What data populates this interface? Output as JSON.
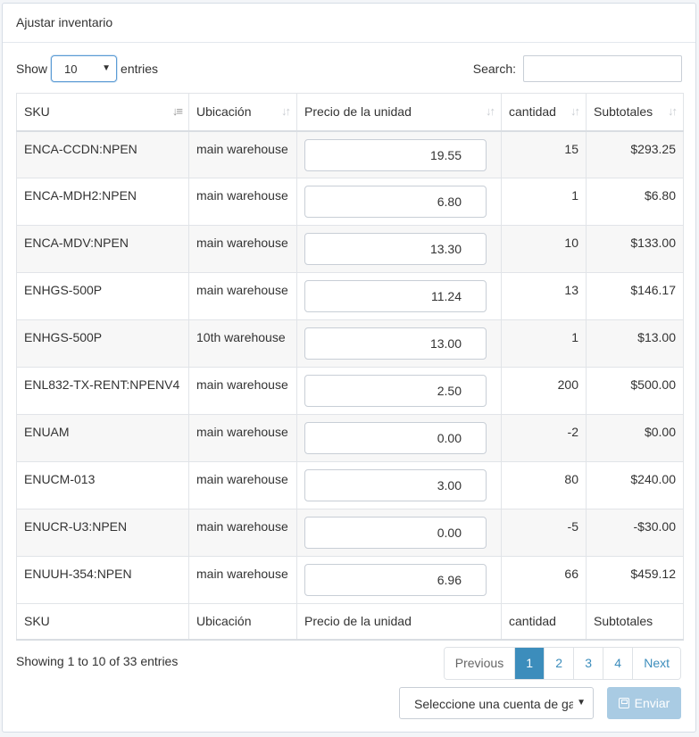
{
  "panel": {
    "title": "Ajustar inventario"
  },
  "length": {
    "show_label": "Show",
    "entries_label": "entries",
    "value": "10"
  },
  "search": {
    "label": "Search:",
    "value": ""
  },
  "columns": [
    "SKU",
    "Ubicación",
    "Precio de la unidad",
    "cantidad",
    "Subtotales"
  ],
  "rows": [
    {
      "sku": "ENCA-CCDN:NPEN",
      "location": "main warehouse",
      "price": "19.55",
      "qty": "15",
      "subtotal": "$293.25"
    },
    {
      "sku": "ENCA-MDH2:NPEN",
      "location": "main warehouse",
      "price": "6.80",
      "qty": "1",
      "subtotal": "$6.80"
    },
    {
      "sku": "ENCA-MDV:NPEN",
      "location": "main warehouse",
      "price": "13.30",
      "qty": "10",
      "subtotal": "$133.00"
    },
    {
      "sku": "ENHGS-500P",
      "location": "main warehouse",
      "price": "11.24",
      "qty": "13",
      "subtotal": "$146.17"
    },
    {
      "sku": "ENHGS-500P",
      "location": "10th warehouse",
      "price": "13.00",
      "qty": "1",
      "subtotal": "$13.00"
    },
    {
      "sku": "ENL832-TX-RENT:NPENV4",
      "location": "main warehouse",
      "price": "2.50",
      "qty": "200",
      "subtotal": "$500.00"
    },
    {
      "sku": "ENUAM",
      "location": "main warehouse",
      "price": "0.00",
      "qty": "-2",
      "subtotal": "$0.00"
    },
    {
      "sku": "ENUCM-013",
      "location": "main warehouse",
      "price": "3.00",
      "qty": "80",
      "subtotal": "$240.00"
    },
    {
      "sku": "ENUCR-U3:NPEN",
      "location": "main warehouse",
      "price": "0.00",
      "qty": "-5",
      "subtotal": "-$30.00"
    },
    {
      "sku": "ENUUH-354:NPEN",
      "location": "main warehouse",
      "price": "6.96",
      "qty": "66",
      "subtotal": "$459.12"
    }
  ],
  "info": "Showing 1 to 10 of 33 entries",
  "pagination": {
    "previous": "Previous",
    "pages": [
      "1",
      "2",
      "3",
      "4"
    ],
    "active": "1",
    "next": "Next"
  },
  "account_select": {
    "placeholder": "Seleccione una cuenta de ga"
  },
  "submit": {
    "label": "Enviar",
    "icon": "save-icon"
  },
  "colors": {
    "accent": "#3c8dbc",
    "submit_disabled": "#a9cbe3"
  }
}
